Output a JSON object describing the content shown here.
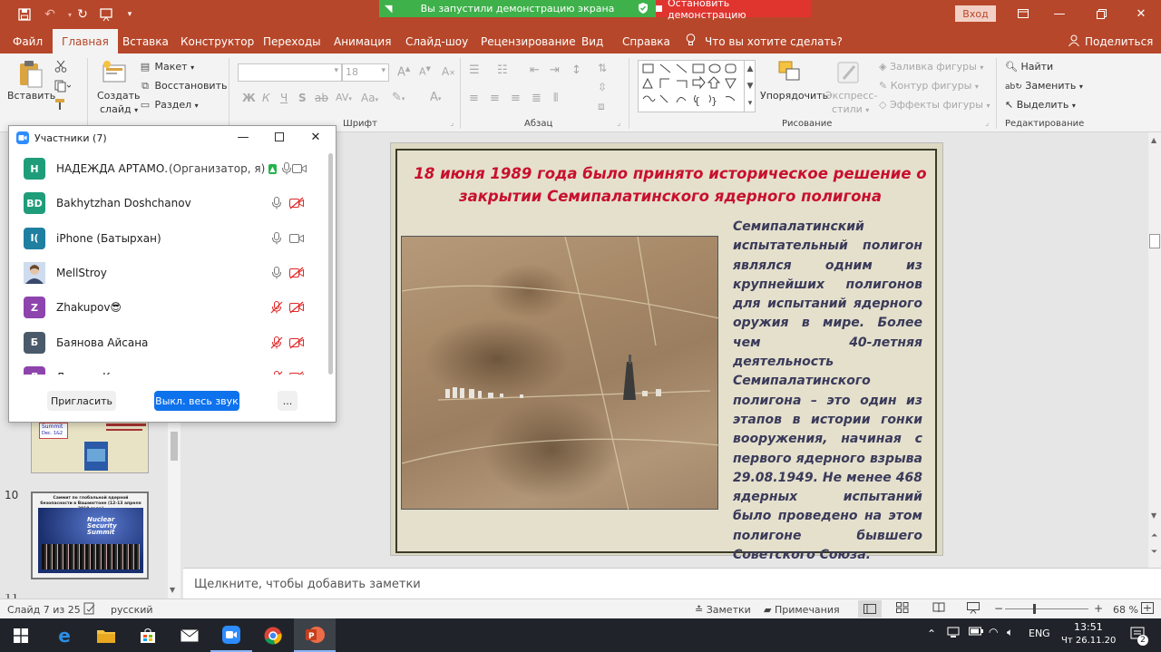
{
  "titlebar": {
    "sharing_label": "Вы запустили демонстрацию экрана",
    "stop_label": "Остановить демонстрацию",
    "login_label": "Вход",
    "brand_color": "#b7472a"
  },
  "tabs": [
    "Файл",
    "Главная",
    "Вставка",
    "Конструктор",
    "Переходы",
    "Анимация",
    "Слайд-шоу",
    "Рецензирование",
    "Вид",
    "Справка"
  ],
  "tell_me": "Что вы хотите сделать?",
  "share_label": "Поделиться",
  "ribbon": {
    "paste": "Вставить",
    "new_slide_1": "Создать",
    "new_slide_2": "слайд",
    "layout": "Макет",
    "reset": "Восстановить",
    "section": "Раздел",
    "font_size": "18",
    "font_group": "Шрифт",
    "paragraph_group": "Абзац",
    "drawing_group": "Рисование",
    "arrange": "Упорядочить",
    "quick_styles_1": "Экспресс-",
    "quick_styles_2": "стили",
    "shape_fill": "Заливка фигуры",
    "shape_outline": "Контур фигуры",
    "shape_effects": "Эффекты фигуры",
    "find": "Найти",
    "replace": "Заменить",
    "select": "Выделить",
    "editing_group": "Редактирование",
    "bold": "Ж",
    "italic": "К",
    "underline": "Ч",
    "strike": "S",
    "shadow": "ab",
    "aa": "Aa",
    "a": "A"
  },
  "panel": {
    "title": "Участники (7)",
    "invite": "Пригласить",
    "mute_all": "Выкл. весь звук",
    "more": "...",
    "participants": [
      {
        "initials": "Н",
        "name": "НАДЕЖДА АРТАМО...",
        "role": "(Организатор, я)",
        "color": "#1f9d7a",
        "mic": "on",
        "cam": "on"
      },
      {
        "initials": "BD",
        "name": "Bakhytzhan Doshchanov",
        "role": "",
        "color": "#1f9d7a",
        "mic": "on",
        "cam": "off"
      },
      {
        "initials": "I(",
        "name": "iPhone (Батырхан)",
        "role": "",
        "color": "#1f7fa0",
        "mic": "on",
        "cam": "on"
      },
      {
        "initials": "",
        "name": "MellStroy",
        "role": "",
        "color": "#9fb6d6",
        "mic": "on",
        "cam": "off"
      },
      {
        "initials": "Z",
        "name": "Zhakupov😎",
        "role": "",
        "color": "#8e44ad",
        "mic": "off",
        "cam": "off"
      },
      {
        "initials": "Б",
        "name": "Баянова Айсана",
        "role": "",
        "color": "#4a5a6a",
        "mic": "off",
        "cam": "off"
      },
      {
        "initials": "Д",
        "name": "Динара Каратаева",
        "role": "",
        "color": "#8e44ad",
        "mic": "off",
        "cam": "off"
      }
    ]
  },
  "slide": {
    "title": "18 июня 1989 года было принято историческое решение о закрытии Семипалатинского ядерного полигона",
    "body": "Семипалатинский испытательный полигон являлся одним из крупнейших полигонов для испытаний ядерного оружия в мире. Более чем 40-летняя деятельность Семипалатинского полигона – это один из этапов в истории гонки вооружения, начиная с первого ядерного взрыва 29.08.1949. Не менее 468 ядерных испытаний было проведено на этом полигоне бывшего Советского Союза."
  },
  "thumbs": {
    "slide10_number": "10",
    "slide10_title": "Саммит по глобальной ядерной безопасности в Вашингтоне (12-13 апреля 2010 года)",
    "slide10_banner_1": "Nuclear",
    "slide10_banner_2": "Security",
    "slide10_banner_3": "Summit",
    "slide9_text_1": "Summit",
    "slide9_text_2": "Dec. 1&2",
    "slide11_number": "11"
  },
  "notes_placeholder": "Щелкните, чтобы добавить заметки",
  "status": {
    "slide_info": "Слайд 7 из 25",
    "language": "русский",
    "notes": "Заметки",
    "comments": "Примечания",
    "zoom": "68 %",
    "minus": "−",
    "plus": "+"
  },
  "taskbar": {
    "lang": "ENG",
    "time": "13:51",
    "date": "Чт 26.11.20",
    "notif_count": "2"
  }
}
